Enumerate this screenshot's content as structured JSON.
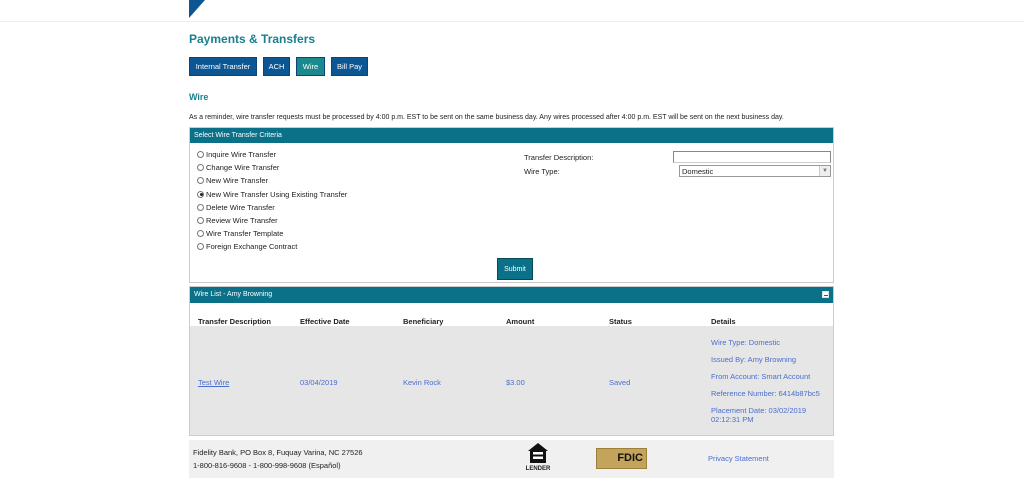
{
  "page": {
    "title": "Payments & Transfers",
    "section": "Wire",
    "reminder": "As a reminder, wire transfer requests must be processed by 4:00 p.m. EST to be sent on the same business day. Any wires processed after 4:00 p.m. EST will be sent on the next business day."
  },
  "tabs": [
    {
      "label": "Internal Transfer"
    },
    {
      "label": "ACH"
    },
    {
      "label": "Wire",
      "active": true
    },
    {
      "label": "Bill Pay"
    }
  ],
  "criteria": {
    "header": "Select Wire Transfer Criteria",
    "options": [
      "Inquire Wire Transfer",
      "Change Wire Transfer",
      "New Wire Transfer",
      "New Wire Transfer Using Existing Transfer",
      "Delete Wire Transfer",
      "Review Wire Transfer",
      "Wire Transfer Template",
      "Foreign Exchange Contract"
    ],
    "selected": "New Wire Transfer Using Existing Transfer",
    "desc_label": "Transfer Description:",
    "desc_value": "",
    "type_label": "Wire Type:",
    "type_value": "Domestic",
    "submit": "Submit"
  },
  "wirelist": {
    "header": "Wire List - Amy Browning",
    "columns": [
      "Transfer Description",
      "Effective Date",
      "Beneficiary",
      "Amount",
      "Status",
      "Details"
    ],
    "rows": [
      {
        "description": "Test Wire",
        "date": "03/04/2019",
        "beneficiary": "Kevin Rock",
        "amount": "$3.00",
        "status": "Saved",
        "details": [
          "Wire Type: Domestic",
          "Issued By: Amy Browning",
          "From Account: Smart Account",
          "Reference Number: 6414b87bc5",
          "Placement Date: 03/02/2019 02:12:31 PM"
        ]
      }
    ]
  },
  "footer": {
    "address": "Fidelity Bank, PO Box 8, Fuquay Varina, NC 27526",
    "phone": "1-800-816-9608 - 1-800-998-9608 (Español)",
    "ehl": "EQUAL HOUSING LENDER",
    "fdic": "FDIC",
    "privacy": "Privacy Statement"
  },
  "colors": {
    "primary": "#0d5694",
    "teal": "#0b7189",
    "link": "#4a6ed0"
  }
}
